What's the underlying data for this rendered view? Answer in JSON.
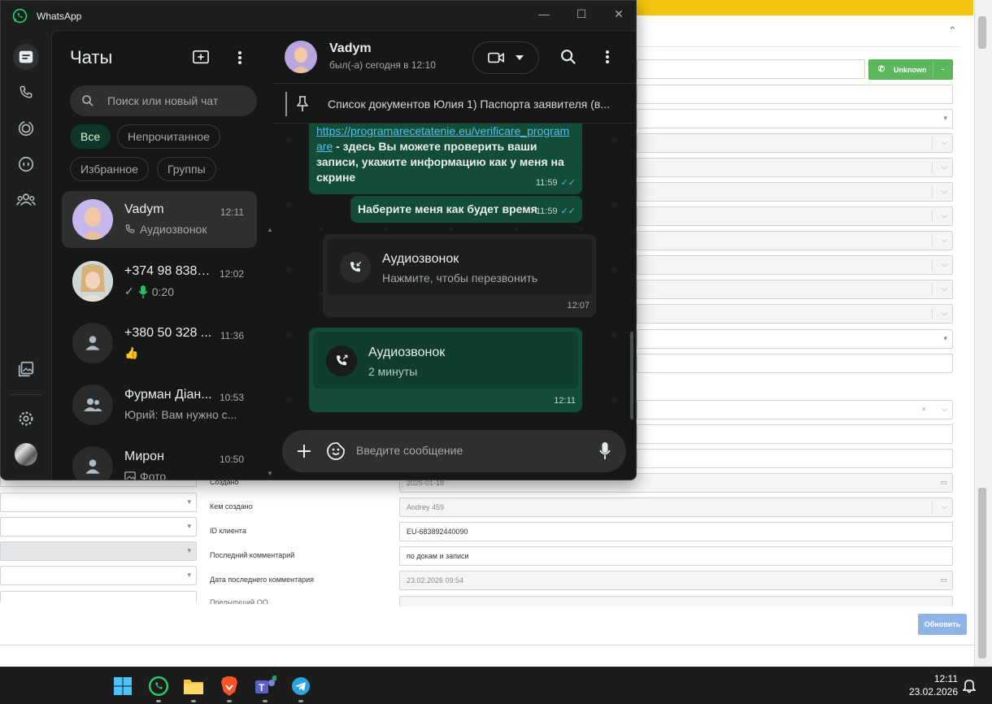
{
  "window": {
    "title": "WhatsApp"
  },
  "sidebar": {
    "heading": "Чаты"
  },
  "search": {
    "placeholder": "Поиск или новый чат"
  },
  "filters": [
    "Все",
    "Непрочитанное",
    "Избранное",
    "Группы"
  ],
  "chats": [
    {
      "name": "Vadym",
      "time": "12:11",
      "preview": "Аудиозвонок",
      "preview_icon": "phone-call-icon",
      "selected": true
    },
    {
      "name": "+374 98 8388...",
      "time": "12:02",
      "preview": "0:20",
      "preview_icon": "mic-icon",
      "selected": false
    },
    {
      "name": "+380 50 328 ...",
      "time": "11:36",
      "preview": "👍",
      "preview_icon": "",
      "selected": false
    },
    {
      "name": "Фурман Діан...",
      "time": "10:53",
      "preview": "Юрий: Вам нужно с...",
      "preview_icon": "",
      "selected": false
    },
    {
      "name": "Мирон",
      "time": "10:50",
      "preview": "Фото",
      "preview_icon": "photo-icon",
      "selected": false
    }
  ],
  "conversation": {
    "contact_name": "Vadym",
    "status": "был(-а) сегодня в 12:10",
    "pinned": "Список документов Юлия 1) Паспорта заявителя (в...",
    "messages": {
      "m1_link": "https://programarecetatenie.eu/verificare_programare",
      "m1_text": " - здесь Вы можете проверить ваши записи, укажите информацию как у меня на скрине",
      "m1_time": "11:59",
      "m2_text": "Наберите меня как будет время",
      "m2_time": "11:59",
      "call_in_title": "Аудиозвонок",
      "call_in_sub": "Нажмите, чтобы перезвонить",
      "call_in_time": "12:07",
      "call_out_title": "Аудиозвонок",
      "call_out_sub": "2 минуты",
      "call_out_time": "12:11"
    },
    "composer_placeholder": "Введите сообщение"
  },
  "crm": {
    "unknown_button": "Unknown",
    "labels": {
      "created": "Создано",
      "created_by": "Кем создано",
      "client_id": "ID клиента",
      "last_comment": "Последний комментарий",
      "last_comment_date": "Дата последнего комментария",
      "previous": "Предыдущий ОО"
    },
    "values": {
      "created": "2026-01-18",
      "created_by": "Andrey 459",
      "client_id": "EU-683892440090",
      "last_comment": "по докам и записи",
      "last_comment_date": "23.02.2026 09:54"
    },
    "refresh_button": "Обновить"
  },
  "taskbar": {
    "time": "12:11",
    "date": "23.02.2026"
  },
  "colors": {
    "wa_green": "#25d366",
    "bubble_out": "#144d37",
    "accent": "#f1c40f"
  }
}
